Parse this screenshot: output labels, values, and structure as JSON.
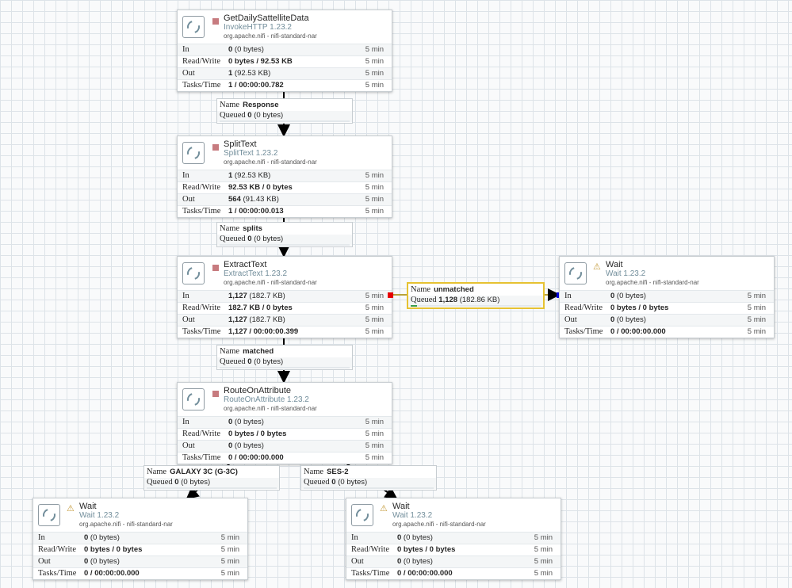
{
  "processors": {
    "get": {
      "name": "GetDailySattelliteData",
      "type": "InvokeHTTP 1.23.2",
      "bundle": "org.apache.nifi - nifi-standard-nar",
      "stats": [
        {
          "label": "In",
          "bold": "0",
          "rest": " (0 bytes)",
          "window": "5 min"
        },
        {
          "label": "Read/Write",
          "bold": "0 bytes / 92.53 KB",
          "rest": "",
          "window": "5 min"
        },
        {
          "label": "Out",
          "bold": "1",
          "rest": " (92.53 KB)",
          "window": "5 min"
        },
        {
          "label": "Tasks/Time",
          "bold": "1 / 00:00:00.782",
          "rest": "",
          "window": "5 min"
        }
      ]
    },
    "split": {
      "name": "SplitText",
      "type": "SplitText 1.23.2",
      "bundle": "org.apache.nifi - nifi-standard-nar",
      "stats": [
        {
          "label": "In",
          "bold": "1",
          "rest": " (92.53 KB)",
          "window": "5 min"
        },
        {
          "label": "Read/Write",
          "bold": "92.53 KB / 0 bytes",
          "rest": "",
          "window": "5 min"
        },
        {
          "label": "Out",
          "bold": "564",
          "rest": " (91.43 KB)",
          "window": "5 min"
        },
        {
          "label": "Tasks/Time",
          "bold": "1 / 00:00:00.013",
          "rest": "",
          "window": "5 min"
        }
      ]
    },
    "extract": {
      "name": "ExtractText",
      "type": "ExtractText 1.23.2",
      "bundle": "org.apache.nifi - nifi-standard-nar",
      "stats": [
        {
          "label": "In",
          "bold": "1,127",
          "rest": " (182.7 KB)",
          "window": "5 min"
        },
        {
          "label": "Read/Write",
          "bold": "182.7 KB / 0 bytes",
          "rest": "",
          "window": "5 min"
        },
        {
          "label": "Out",
          "bold": "1,127",
          "rest": " (182.7 KB)",
          "window": "5 min"
        },
        {
          "label": "Tasks/Time",
          "bold": "1,127 / 00:00:00.399",
          "rest": "",
          "window": "5 min"
        }
      ]
    },
    "route": {
      "name": "RouteOnAttribute",
      "type": "RouteOnAttribute 1.23.2",
      "bundle": "org.apache.nifi - nifi-standard-nar",
      "stats": [
        {
          "label": "In",
          "bold": "0",
          "rest": " (0 bytes)",
          "window": "5 min"
        },
        {
          "label": "Read/Write",
          "bold": "0 bytes / 0 bytes",
          "rest": "",
          "window": "5 min"
        },
        {
          "label": "Out",
          "bold": "0",
          "rest": " (0 bytes)",
          "window": "5 min"
        },
        {
          "label": "Tasks/Time",
          "bold": "0 / 00:00:00.000",
          "rest": "",
          "window": "5 min"
        }
      ]
    },
    "wait1": {
      "name": "Wait",
      "type": "Wait 1.23.2",
      "bundle": "org.apache.nifi - nifi-standard-nar",
      "stats": [
        {
          "label": "In",
          "bold": "0",
          "rest": " (0 bytes)",
          "window": "5 min"
        },
        {
          "label": "Read/Write",
          "bold": "0 bytes / 0 bytes",
          "rest": "",
          "window": "5 min"
        },
        {
          "label": "Out",
          "bold": "0",
          "rest": " (0 bytes)",
          "window": "5 min"
        },
        {
          "label": "Tasks/Time",
          "bold": "0 / 00:00:00.000",
          "rest": "",
          "window": "5 min"
        }
      ]
    },
    "wait2": {
      "name": "Wait",
      "type": "Wait 1.23.2",
      "bundle": "org.apache.nifi - nifi-standard-nar",
      "stats": [
        {
          "label": "In",
          "bold": "0",
          "rest": " (0 bytes)",
          "window": "5 min"
        },
        {
          "label": "Read/Write",
          "bold": "0 bytes / 0 bytes",
          "rest": "",
          "window": "5 min"
        },
        {
          "label": "Out",
          "bold": "0",
          "rest": " (0 bytes)",
          "window": "5 min"
        },
        {
          "label": "Tasks/Time",
          "bold": "0 / 00:00:00.000",
          "rest": "",
          "window": "5 min"
        }
      ]
    },
    "wait3": {
      "name": "Wait",
      "type": "Wait 1.23.2",
      "bundle": "org.apache.nifi - nifi-standard-nar",
      "stats": [
        {
          "label": "In",
          "bold": "0",
          "rest": " (0 bytes)",
          "window": "5 min"
        },
        {
          "label": "Read/Write",
          "bold": "0 bytes / 0 bytes",
          "rest": "",
          "window": "5 min"
        },
        {
          "label": "Out",
          "bold": "0",
          "rest": " (0 bytes)",
          "window": "5 min"
        },
        {
          "label": "Tasks/Time",
          "bold": "0 / 00:00:00.000",
          "rest": "",
          "window": "5 min"
        }
      ]
    }
  },
  "connections": {
    "response": {
      "name_label": "Name",
      "name": "Response",
      "queued_label": "Queued",
      "queued_count": "0",
      "queued_size": " (0 bytes)",
      "fill": 0
    },
    "splits": {
      "name_label": "Name",
      "name": "splits",
      "queued_label": "Queued",
      "queued_count": "0",
      "queued_size": " (0 bytes)",
      "fill": 0
    },
    "unmatched": {
      "name_label": "Name",
      "name": "unmatched",
      "queued_label": "Queued",
      "queued_count": "1,128",
      "queued_size": " (182.86 KB)",
      "fill": 0.05
    },
    "matched": {
      "name_label": "Name",
      "name": "matched",
      "queued_label": "Queued",
      "queued_count": "0",
      "queued_size": " (0 bytes)",
      "fill": 0
    },
    "galaxy": {
      "name_label": "Name",
      "name": "GALAXY 3C (G-3C)",
      "queued_label": "Queued",
      "queued_count": "0",
      "queued_size": " (0 bytes)",
      "fill": 0
    },
    "ses": {
      "name_label": "Name",
      "name": "SES-2",
      "queued_label": "Queued",
      "queued_count": "0",
      "queued_size": " (0 bytes)",
      "fill": 0
    }
  },
  "colors": {
    "canvas": "#f9fafb",
    "grid": "#dde3e8",
    "stopped": "#c77b7f",
    "warning": "#c49a3a",
    "selected": "#e6c232",
    "link": "#000000",
    "queue_fill": "#3a9c4c",
    "source_port": "#e60000",
    "dest_port": "#0000e6"
  },
  "icons": {
    "processor": "processor-icon",
    "stopped": "stop-icon",
    "invalid": "warning-icon"
  }
}
